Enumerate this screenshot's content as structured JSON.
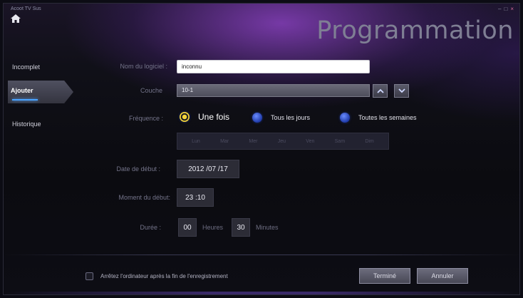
{
  "window": {
    "app_name": "Acoot TV Sus",
    "title": "Programmation",
    "controls": {
      "minimize": "–",
      "maximize": "□",
      "close": "×"
    }
  },
  "sidebar": {
    "items": [
      {
        "label": "Incomplet",
        "active": false
      },
      {
        "label": "Ajouter",
        "active": true
      },
      {
        "label": "Historique",
        "active": false
      }
    ]
  },
  "form": {
    "name": {
      "label": "Nom du logiciel :",
      "value": "inconnu"
    },
    "layer": {
      "label": "Couche",
      "value": "10-1"
    },
    "frequency": {
      "label": "Fréquence :",
      "options": [
        {
          "label": "Une fois",
          "selected": true
        },
        {
          "label": "Tous les jours",
          "selected": false
        },
        {
          "label": "Toutes les semaines",
          "selected": false
        }
      ],
      "days": [
        "Lun",
        "Mar",
        "Mer",
        "Jeu",
        "Ven",
        "Sam",
        "Dim"
      ]
    },
    "start_date": {
      "label": "Date de début :",
      "value": "2012 /07 /17"
    },
    "start_time": {
      "label": "Moment du début:",
      "value": "23 :10"
    },
    "duration": {
      "label": "Durée :",
      "hours": "00",
      "hours_unit": "Heures",
      "minutes": "30",
      "minutes_unit": "Minutes"
    }
  },
  "footer": {
    "checkbox_label": "Arrêtez l'ordinateur après la fin de l'enregistrement",
    "checkbox_checked": false,
    "done_label": "Terminé",
    "cancel_label": "Annuler"
  },
  "colors": {
    "accent_blue": "#4aa3ff",
    "radio_selected": "#f3d43a",
    "radio_unselected": "#3a5cd8",
    "header_purple": "#9646d2"
  },
  "icons": [
    "home-icon",
    "chevron-up-icon",
    "chevron-down-icon"
  ]
}
